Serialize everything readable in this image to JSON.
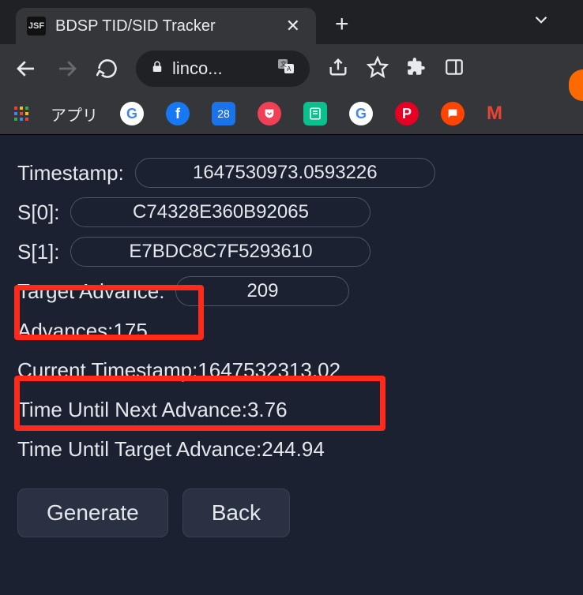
{
  "tab": {
    "favicon_text": "JSF",
    "title": "BDSP TID/SID Tracker"
  },
  "omnibox": {
    "url_display": "linco..."
  },
  "bookmarks": {
    "apps_label": "アプリ",
    "calendar_day": "28"
  },
  "tracker": {
    "timestamp_label": "Timestamp:",
    "timestamp_value": "1647530973.0593226",
    "s0_label": "S[0]:",
    "s0_value": "C74328E360B92065",
    "s1_label": "S[1]:",
    "s1_value": "E7BDC8C7F5293610",
    "target_advance_label": "Target Advance:",
    "target_advance_value": "209",
    "advances_label": "Advances: ",
    "advances_value": "175",
    "current_ts_label": "Current Timestamp: ",
    "current_ts_value": "1647532313.02",
    "time_next_label": "Time Until Next Advance: ",
    "time_next_value": "3.76",
    "time_target_label": "Time Until Target Advance: ",
    "time_target_value": "244.94",
    "generate_btn": "Generate",
    "back_btn": "Back"
  }
}
